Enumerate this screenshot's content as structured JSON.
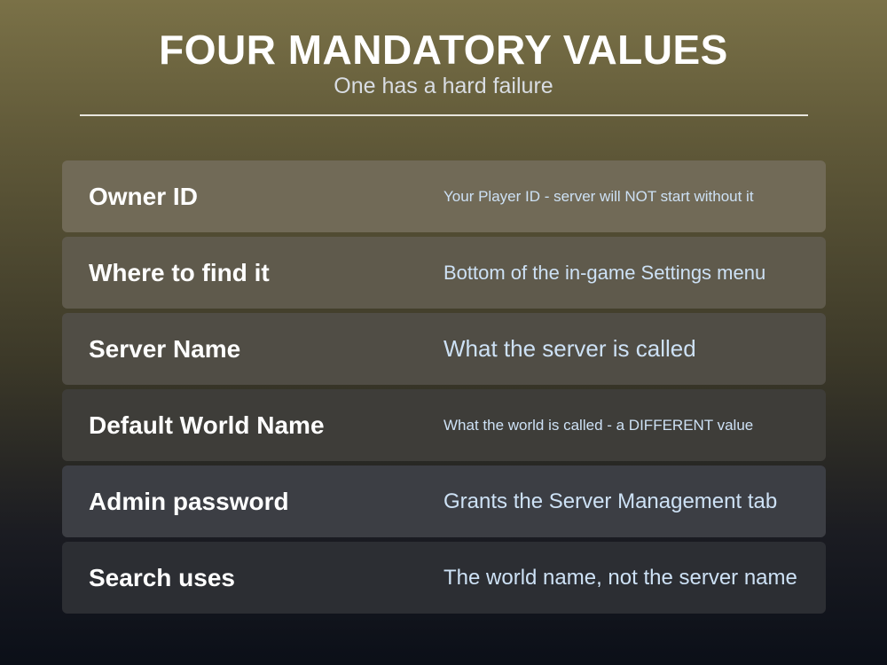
{
  "header": {
    "title": "FOUR MANDATORY VALUES",
    "subtitle": "One has a hard failure"
  },
  "rows": [
    {
      "label": "Owner ID",
      "value": "Your Player ID - server will NOT start without it"
    },
    {
      "label": "Where to find it",
      "value": "Bottom of the in-game Settings menu"
    },
    {
      "label": "Server Name",
      "value": "What the server is called"
    },
    {
      "label": "Default World Name",
      "value": "What the world is called - a DIFFERENT value"
    },
    {
      "label": "Admin password",
      "value": "Grants the Server Management tab"
    },
    {
      "label": "Search uses",
      "value": "The world name, not the server name"
    }
  ]
}
